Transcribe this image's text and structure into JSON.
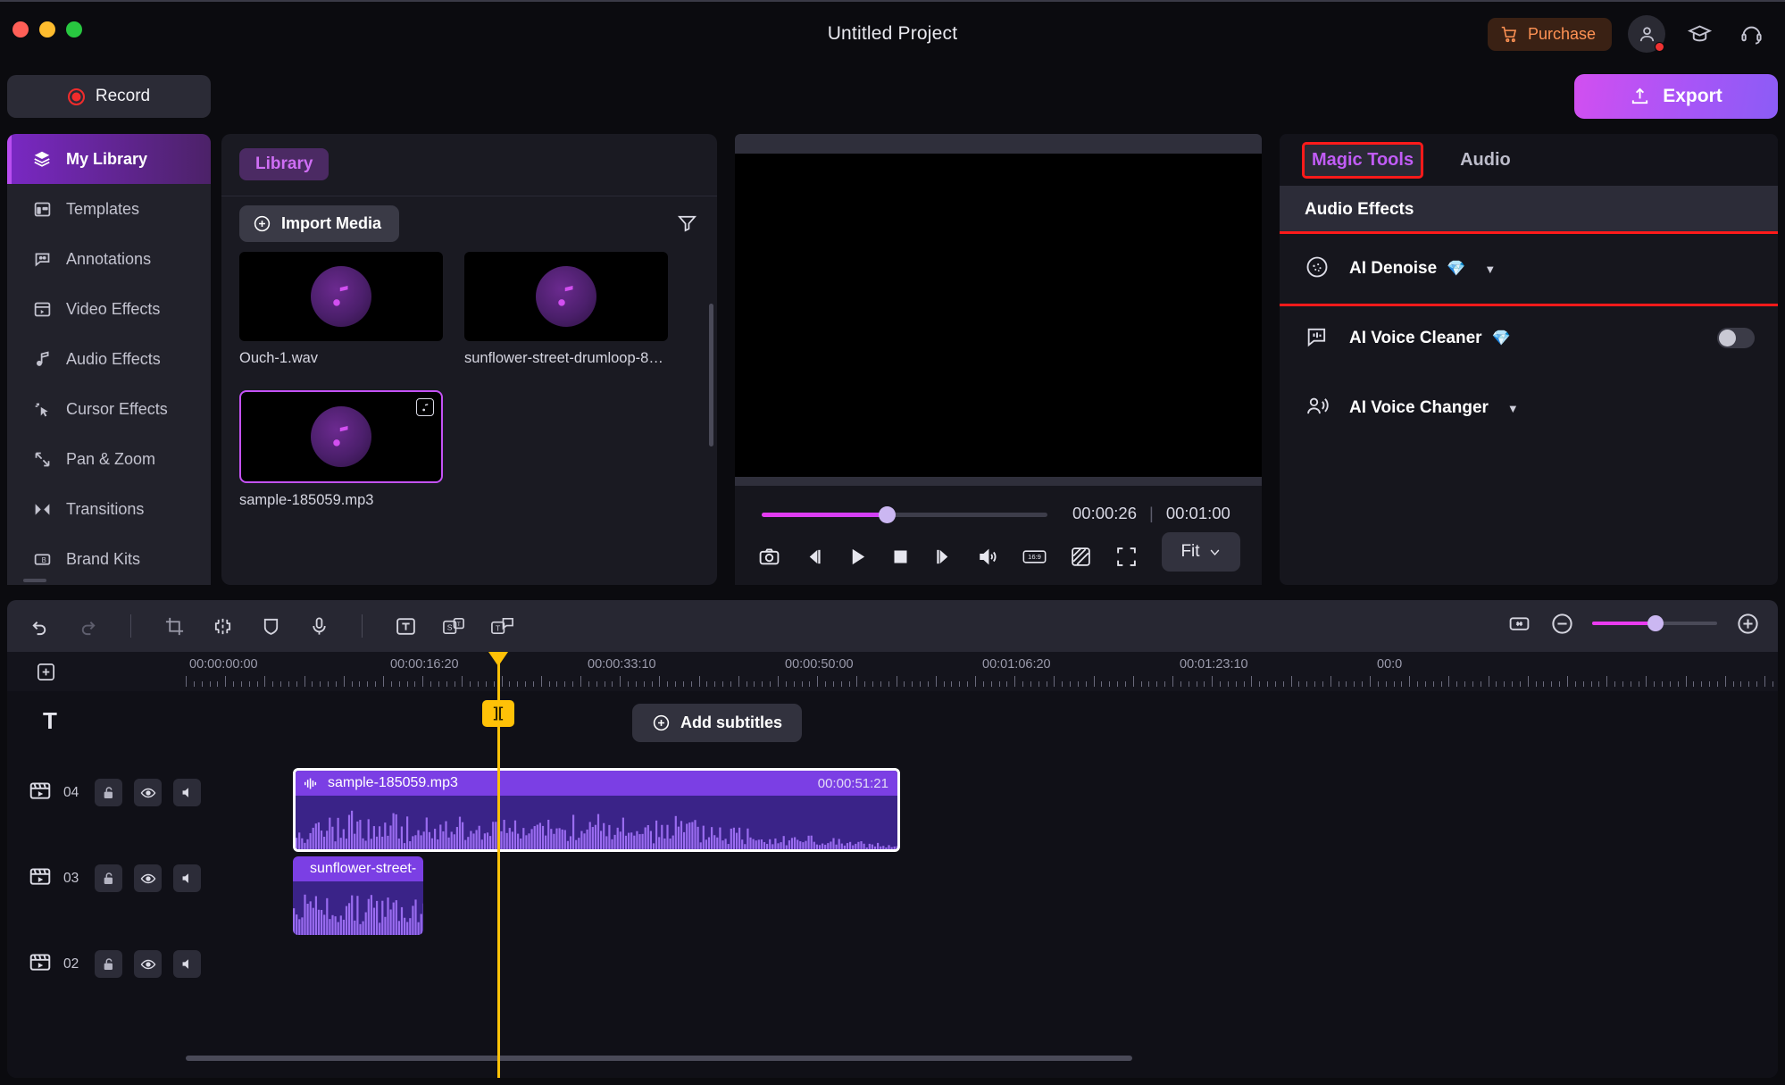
{
  "window": {
    "title": "Untitled Project",
    "traffic_lights": [
      "close-red",
      "minimize-yellow",
      "maximize-green"
    ],
    "purchase_label": "Purchase",
    "icons": [
      "account-icon",
      "graduation-cap-icon",
      "headset-icon"
    ]
  },
  "actionbar": {
    "record_label": "Record",
    "export_label": "Export"
  },
  "sidebar": {
    "items": [
      {
        "label": "My Library",
        "icon": "layers-icon",
        "active": true
      },
      {
        "label": "Templates",
        "icon": "template-icon",
        "active": false
      },
      {
        "label": "Annotations",
        "icon": "annotation-icon",
        "active": false
      },
      {
        "label": "Video Effects",
        "icon": "video-effects-icon",
        "active": false
      },
      {
        "label": "Audio Effects",
        "icon": "audio-note-icon",
        "active": false
      },
      {
        "label": "Cursor Effects",
        "icon": "cursor-click-icon",
        "active": false
      },
      {
        "label": "Pan & Zoom",
        "icon": "pan-zoom-icon",
        "active": false
      },
      {
        "label": "Transitions",
        "icon": "transitions-icon",
        "active": false
      },
      {
        "label": "Brand Kits",
        "icon": "brand-kit-icon",
        "active": false
      }
    ]
  },
  "library": {
    "tab_label": "Library",
    "import_label": "Import Media",
    "filter_icon": "filter-funnel-icon",
    "media": [
      {
        "name": "Ouch-1.wav",
        "selected": false,
        "badge": false
      },
      {
        "name": "sunflower-street-drumloop-8…",
        "selected": false,
        "badge": false
      },
      {
        "name": "sample-185059.mp3",
        "selected": true,
        "badge": true
      }
    ]
  },
  "preview": {
    "current_time": "00:00:26",
    "separator": "|",
    "total_time": "00:01:00",
    "progress_percent": 43,
    "controls": [
      "snapshot-camera-icon",
      "previous-frame-icon",
      "play-icon",
      "stop-icon",
      "next-frame-icon",
      "volume-icon",
      "aspect-16-9-icon",
      "no-signal-icon",
      "fullscreen-icon"
    ],
    "fit_label": "Fit"
  },
  "right_panel": {
    "tabs": [
      {
        "label": "Magic Tools",
        "active": true,
        "highlighted": true
      },
      {
        "label": "Audio",
        "active": false,
        "highlighted": false
      }
    ],
    "section_title": "Audio Effects",
    "rows": [
      {
        "label": "AI Denoise",
        "icon": "denoise-circle-icon",
        "premium": true,
        "caret": true,
        "toggle": null,
        "highlighted": true
      },
      {
        "label": "AI Voice Cleaner",
        "icon": "voice-cleaner-icon",
        "premium": true,
        "caret": false,
        "toggle": "off",
        "highlighted": false
      },
      {
        "label": "AI Voice Changer",
        "icon": "voice-changer-icon",
        "premium": false,
        "caret": true,
        "toggle": null,
        "highlighted": false
      }
    ]
  },
  "timeline": {
    "toolbar_icons": [
      "undo-icon",
      "redo-icon",
      "crop-icon",
      "split-icon",
      "shield-icon",
      "microphone-icon",
      "text-icon",
      "subtitle-icon",
      "caption-icon"
    ],
    "zoom_controls": [
      "fit-timeline-icon",
      "zoom-out-icon",
      "zoom-slider",
      "zoom-in-icon"
    ],
    "zoom_percent": 50,
    "add_track_icon": "add-track-icon",
    "ruler_labels": [
      "00:00:00:00",
      "00:00:16:20",
      "00:00:33:10",
      "00:00:50:00",
      "00:01:06:20",
      "00:01:23:10",
      "00:0"
    ],
    "playhead_marker": "][",
    "add_subtitles_label": "Add subtitles",
    "text_track_icon": "text-track-icon",
    "tracks": [
      {
        "number": "04",
        "icon": "clapperboard-icon",
        "buttons": [
          "unlock-icon",
          "eye-icon",
          "mute-icon"
        ],
        "clip": {
          "name": "sample-185059.mp3",
          "duration": "00:00:51:21",
          "selected": true
        }
      },
      {
        "number": "03",
        "icon": "clapperboard-icon",
        "buttons": [
          "unlock-icon",
          "eye-icon",
          "mute-icon"
        ],
        "clip": {
          "name": "sunflower-street-",
          "duration": "",
          "selected": false
        }
      },
      {
        "number": "02",
        "icon": "clapperboard-icon",
        "buttons": [
          "unlock-icon",
          "eye-icon",
          "mute-icon"
        ],
        "clip": null
      }
    ]
  },
  "colors": {
    "accent_purple": "#a855f7",
    "accent_magenta": "#e93bf0",
    "highlight_red": "#ff1a1a",
    "playhead_yellow": "#ffc107",
    "clip_purple": "#7b3fe4",
    "purchase_orange": "#ff9254"
  }
}
